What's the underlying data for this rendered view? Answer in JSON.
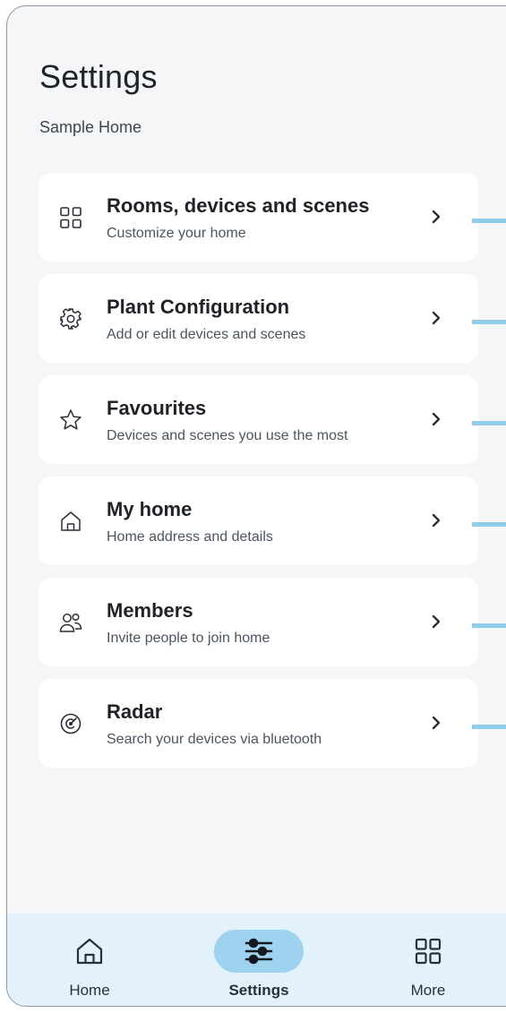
{
  "header": {
    "title": "Settings",
    "subtitle": "Sample Home"
  },
  "menu": [
    {
      "title": "Rooms, devices and scenes",
      "description": "Customize your home",
      "icon": "grid-icon"
    },
    {
      "title": "Plant Configuration",
      "description": "Add or edit devices and scenes",
      "icon": "gear-icon"
    },
    {
      "title": "Favourites",
      "description": "Devices and scenes you use the most",
      "icon": "star-icon"
    },
    {
      "title": "My home",
      "description": "Home address and details",
      "icon": "house-icon"
    },
    {
      "title": "Members",
      "description": "Invite people to join home",
      "icon": "people-icon"
    },
    {
      "title": "Radar",
      "description": "Search your devices via bluetooth",
      "icon": "radar-icon"
    }
  ],
  "bottom_nav": [
    {
      "label": "Home",
      "icon": "house-icon",
      "active": false
    },
    {
      "label": "Settings",
      "icon": "sliders-icon",
      "active": true
    },
    {
      "label": "More",
      "icon": "grid-icon",
      "active": false
    }
  ],
  "colors": {
    "background": "#f4f6f8",
    "card": "#ffffff",
    "nav_background": "#e3f1fa",
    "active_pill": "#9dd3ef",
    "accent_edge": "#8fcdeb",
    "text_primary": "#1f2328"
  }
}
